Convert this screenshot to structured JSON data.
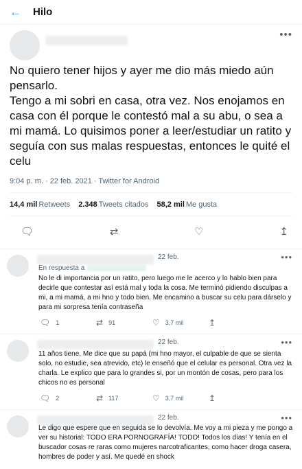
{
  "header": {
    "back_icon": "arrow-left-icon",
    "title": "Hilo",
    "accent": "#1d9bf0"
  },
  "tweet": {
    "lines": [
      "No quiero tener hijos y ayer me dio más miedo aún pensarlo.",
      "Tengo a mi sobri en casa, otra vez. Nos enojamos en casa con él porque le contestó mal a su abu, o sea a mi mamá. Lo quisimos poner a leer/estudiar un ratito y seguía con sus malas respuestas, entonces le quité el celu"
    ],
    "meta": "9:04 p. m. · 22 feb. 2021 · Twitter for Android",
    "stats": {
      "retweets_value": "14,4 mil",
      "retweets_label": "Retweets",
      "quotes_value": "2.348",
      "quotes_label": "Tweets citados",
      "likes_value": "58,2 mil",
      "likes_label": "Me gusta"
    }
  },
  "replies": [
    {
      "date": "22 feb.",
      "in_reply_label": "En respuesta a",
      "text": "No le di importancia por un ratito, pero luego me le acerco y lo hablo bien para decirle que contestar así está mal y toda la cosa. Me terminó pidiendo disculpas a mi, a mi mamá, a mi hno y todo bien. Me encamino a buscar su celu para dárselo y para mi sorpresa tenía contraseña",
      "replies_count": "1",
      "retweets_count": "91",
      "likes_count": "3,7 mil"
    },
    {
      "date": "22 feb.",
      "text": "11 años tiene. Me dice que su papá (mi hno mayor, el culpable de que se sienta solo, no estudie, sea atrevido, etc) le enseñó que el celular es personal. Otra vez la charla. Le explico que para lo grandes si, por un montón de cosas, pero para los chicos no es personal",
      "replies_count": "2",
      "retweets_count": "117",
      "likes_count": "3,7 mil"
    },
    {
      "date": "22 feb.",
      "text": "Le digo que espere que en seguida se lo devolvía. Me voy a mi pieza y me pongo a ver su historial: TODO ERA PORNOGRAFÍA! TODO! Todos los días! Y tenía en el buscador cosas re raras como mujeres narcotraficantes, como hacer droga casera, hombres de poder y así. Me quedé en shock"
    }
  ]
}
